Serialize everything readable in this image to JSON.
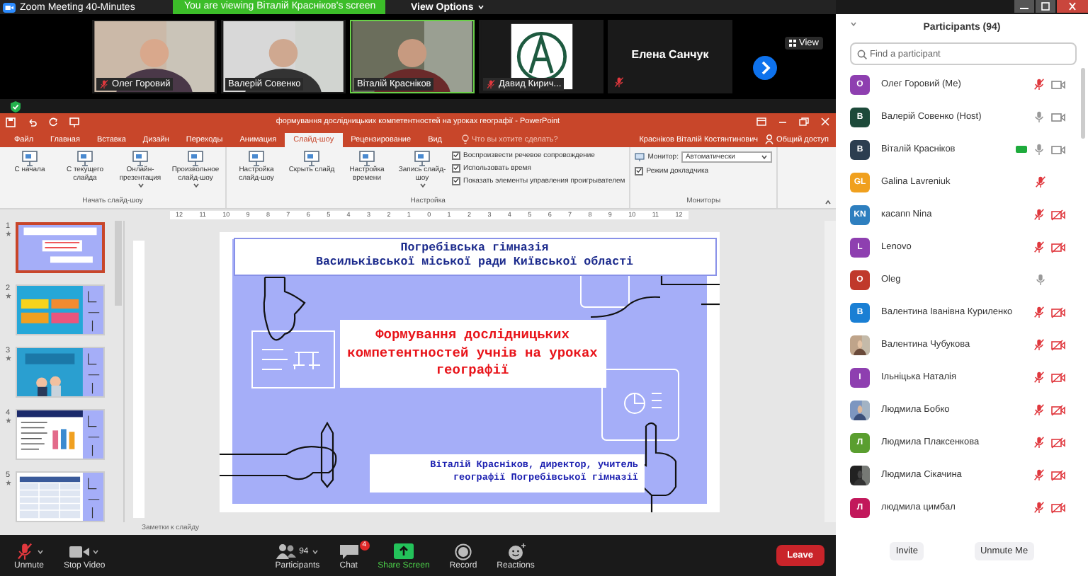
{
  "app_title": "Zoom Meeting 40-Minutes",
  "share_banner": "You are viewing Віталій Красніков's screen",
  "view_options": "View Options",
  "video_tiles": [
    {
      "name": "Олег Горовий",
      "kind": "video",
      "muted": true,
      "speaking": false
    },
    {
      "name": "Валерій Совенко",
      "kind": "video",
      "muted": false,
      "speaking": false
    },
    {
      "name": "Віталій Красніков",
      "kind": "video",
      "muted": false,
      "speaking": true
    },
    {
      "name": "Давид Кирич...",
      "kind": "logo",
      "muted": true,
      "speaking": false
    },
    {
      "name": "Елена Санчук",
      "kind": "name",
      "muted": true,
      "speaking": false
    }
  ],
  "view_button": "View",
  "presentation": {
    "title": "формування дослідницьких компетентностей на уроках географії - PowerPoint",
    "tabs": [
      {
        "label": "Файл",
        "selected": false
      },
      {
        "label": "Главная",
        "selected": false
      },
      {
        "label": "Вставка",
        "selected": false
      },
      {
        "label": "Дизайн",
        "selected": false
      },
      {
        "label": "Переходы",
        "selected": false
      },
      {
        "label": "Анимация",
        "selected": false
      },
      {
        "label": "Слайд-шоу",
        "selected": true
      },
      {
        "label": "Рецензирование",
        "selected": false
      },
      {
        "label": "Вид",
        "selected": false
      }
    ],
    "tell_me": "Что вы хотите сделать?",
    "user": "Красніков Віталій Костянтинович",
    "share": "Общий доступ",
    "groups": [
      {
        "label": "Начать слайд-шоу",
        "commands": [
          {
            "label": "С начала",
            "menu": false
          },
          {
            "label": "С текущего слайда",
            "menu": false
          },
          {
            "label": "Онлайн-презентация",
            "menu": true
          },
          {
            "label": "Произвольное слайд-шоу",
            "menu": true
          }
        ]
      },
      {
        "label": "Настройка",
        "commands": [
          {
            "label": "Настройка слайд-шоу",
            "menu": false
          },
          {
            "label": "Скрыть слайд",
            "menu": false
          },
          {
            "label": "Настройка времени",
            "menu": false
          },
          {
            "label": "Запись слайд-шоу",
            "menu": true
          }
        ],
        "options": [
          {
            "label": "Воспроизвести речевое сопровождение",
            "checked": true
          },
          {
            "label": "Использовать время",
            "checked": true
          },
          {
            "label": "Показать элементы управления проигрывателем",
            "checked": true
          }
        ]
      },
      {
        "label": "Мониторы",
        "monitor_label": "Монитор:",
        "monitor_value": "Автоматически",
        "options": [
          {
            "label": "Режим докладчика",
            "checked": true
          }
        ]
      }
    ],
    "ruler": [
      "12",
      "11",
      "10",
      "9",
      "8",
      "7",
      "6",
      "5",
      "4",
      "3",
      "2",
      "1",
      "0",
      "1",
      "2",
      "3",
      "4",
      "5",
      "6",
      "7",
      "8",
      "9",
      "10",
      "11",
      "12"
    ],
    "slides": [
      {
        "number": "1",
        "kind": "title",
        "selected": true
      },
      {
        "number": "2",
        "kind": "banner",
        "selected": false
      },
      {
        "number": "3",
        "selected": false
      },
      {
        "number": "4",
        "kind": "list",
        "selected": false
      },
      {
        "number": "5",
        "kind": "table",
        "selected": false
      }
    ],
    "slide": {
      "header_lines": [
        "Погребівська гімназія",
        "Васильківської міської ради Київської області"
      ],
      "title": "Формування дослідницьких компетентностей учнів на уроках географії",
      "author": "Віталій Красніков, директор, учитель географії Погребівської гімназії"
    },
    "notes": "Заметки к слайду"
  },
  "toolbar": [
    {
      "kind": "mic",
      "label": "Unmute",
      "menu": true
    },
    {
      "kind": "video",
      "label": "Stop Video",
      "menu": true
    },
    {
      "kind": "participants",
      "label": "Participants",
      "count": "94",
      "menu": true
    },
    {
      "kind": "chat",
      "label": "Chat",
      "badge": "4",
      "menu": false
    },
    {
      "kind": "share",
      "label": "Share Screen",
      "menu": false
    },
    {
      "kind": "record",
      "label": "Record",
      "menu": false
    },
    {
      "kind": "reactions",
      "label": "Reactions",
      "menu": false
    }
  ],
  "leave": "Leave",
  "panel": {
    "title": "Participants (94)",
    "search": {
      "placeholder": "Find a participant"
    },
    "participants": [
      {
        "name": "Олег Горовий (Me)",
        "kind": "letter",
        "avatar": "О",
        "color": "#8e3fb0",
        "sharing": false,
        "muted": true,
        "video_blocked": false
      },
      {
        "name": "Валерій Совенко (Host)",
        "kind": "letter",
        "avatar": "В",
        "color": "#1d4a3a",
        "sharing": false,
        "muted": false,
        "video_blocked": false
      },
      {
        "name": "Віталій Красніков",
        "kind": "letter",
        "avatar": "В",
        "color": "#2c3e50",
        "sharing": true,
        "muted": false,
        "video_blocked": false
      },
      {
        "name": "Galina Lavreniuk",
        "kind": "letter",
        "avatar": "GL",
        "color": "#f0a01e",
        "sharing": false,
        "muted": true
      },
      {
        "name": "касапп  Nina",
        "kind": "letter",
        "avatar": "KN",
        "color": "#2e7fbf",
        "sharing": false,
        "muted": true,
        "video_blocked": true
      },
      {
        "name": "Lenovo",
        "kind": "letter",
        "avatar": "L",
        "color": "#8e3fb0",
        "sharing": false,
        "muted": true,
        "video_blocked": true
      },
      {
        "name": "Oleg",
        "kind": "letter",
        "avatar": "O",
        "color": "#c0392b",
        "sharing": false,
        "muted": false
      },
      {
        "name": "Валентина Іванівна Куриленко",
        "kind": "letter",
        "avatar": "В",
        "color": "#1a7fd4",
        "sharing": false,
        "muted": true,
        "video_blocked": true
      },
      {
        "name": "Валентина Чубукова",
        "sharing": false,
        "muted": true,
        "video_blocked": true
      },
      {
        "name": "Ільніцька Наталія",
        "kind": "letter",
        "avatar": "І",
        "color": "#8e3fb0",
        "sharing": false,
        "muted": true,
        "video_blocked": true
      },
      {
        "name": "Людмила Бобко",
        "sharing": false,
        "muted": true,
        "video_blocked": true
      },
      {
        "name": "Людмила Плаксенкова",
        "kind": "letter",
        "avatar": "Л",
        "color": "#5a9e2f",
        "sharing": false,
        "muted": true,
        "video_blocked": true
      },
      {
        "name": "Людмила Сікачина",
        "sharing": false,
        "muted": true,
        "video_blocked": true
      },
      {
        "name": "людмила цимбал",
        "kind": "letter",
        "avatar": "Л",
        "color": "#c2185b",
        "sharing": false,
        "muted": true,
        "video_blocked": true
      }
    ],
    "buttons": [
      "Invite",
      "Unmute Me"
    ]
  }
}
